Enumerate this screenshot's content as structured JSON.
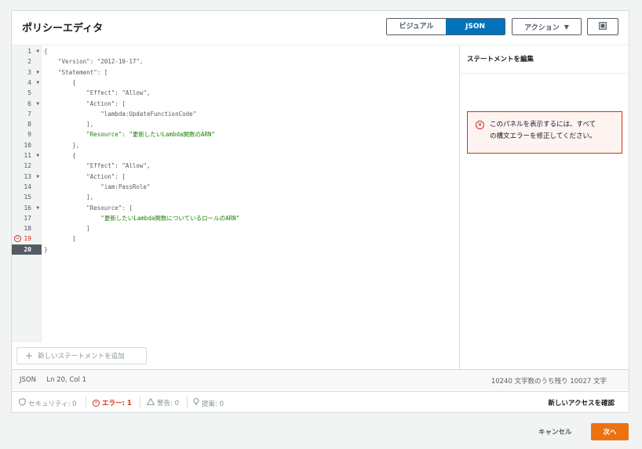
{
  "header": {
    "title": "ポリシーエディタ",
    "tabs": [
      {
        "label": "ビジュアル",
        "active": false
      },
      {
        "label": "JSON",
        "active": true
      }
    ],
    "actions_label": "アクション",
    "actions_icon": "caret-down-icon",
    "preferences_icon": "settings-square-icon"
  },
  "editor": {
    "line_numbers": [
      "1",
      "2",
      "3",
      "4",
      "5",
      "6",
      "7",
      "8",
      "9",
      "10",
      "11",
      "12",
      "13",
      "14",
      "15",
      "16",
      "17",
      "18",
      "19",
      "20"
    ],
    "lines": [
      "{",
      "    \"Version\": \"2012-10-17\",",
      "    \"Statement\": [",
      "        {",
      "            \"Effect\": \"Allow\",",
      "            \"Action\": [",
      "                \"lambda:UpdateFunctionCode\"",
      "            ],",
      "            \"Resource\": \"更新したいLambda関数のARN\"",
      "        },",
      "        {",
      "            \"Effect\": \"Allow\",",
      "            \"Action\": [",
      "                \"iam:PassRole\"",
      "            ],",
      "            \"Resource\": [",
      "                \"更新したいLambda関数についているロールのARN\"",
      "            ]",
      "        ]",
      "}"
    ],
    "error_line": "19",
    "current_line": "20",
    "add_statement_label": "新しいステートメントを追加"
  },
  "side": {
    "title": "ステートメントを編集",
    "alert_line1": "このパネルを表示するには、すべて",
    "alert_line2": "の構文エラーを修正してください。"
  },
  "status": {
    "mode": "JSON",
    "position": "Ln 20, Col 1",
    "chars_remaining": "10240 文字数のうち残り 10027 文字"
  },
  "footer": {
    "security": "セキュリティ: 0",
    "errors": "エラー: 1",
    "warnings": "警告: 0",
    "suggestions": "提案: 0",
    "review_label": "新しいアクセスを確認"
  },
  "buttons": {
    "cancel": "キャンセル",
    "next": "次へ"
  }
}
